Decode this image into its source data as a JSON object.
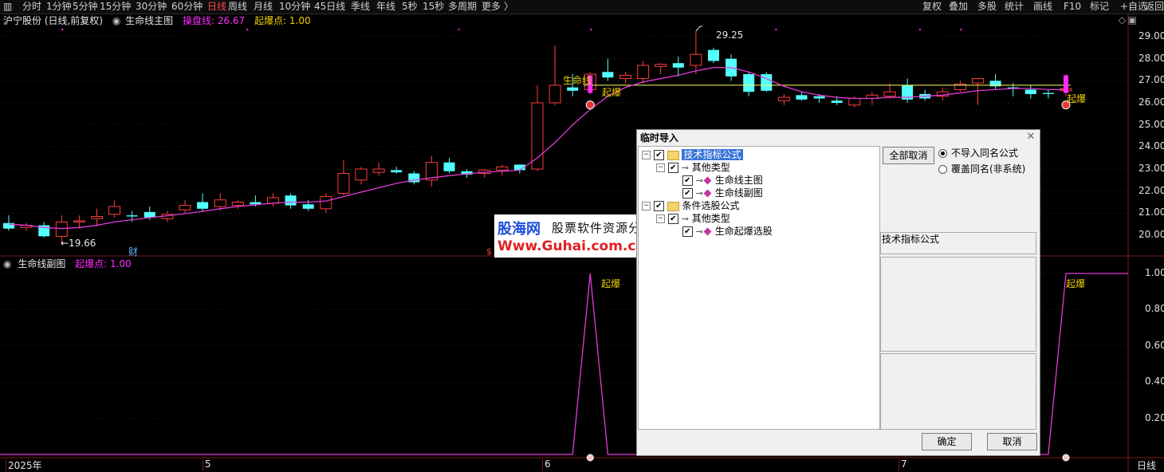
{
  "toolbar": {
    "menu_icon": "menu-icon",
    "periods": [
      {
        "label": "分时",
        "active": false
      },
      {
        "label": "1分钟",
        "active": false
      },
      {
        "label": "5分钟",
        "active": false
      },
      {
        "label": "15分钟",
        "active": false
      },
      {
        "label": "30分钟",
        "active": false
      },
      {
        "label": "60分钟",
        "active": false
      },
      {
        "label": "日线",
        "active": true
      },
      {
        "label": "周线",
        "active": false
      },
      {
        "label": "月线",
        "active": false
      },
      {
        "label": "10分钟",
        "active": false
      },
      {
        "label": "45日线",
        "active": false
      },
      {
        "label": "季线",
        "active": false
      },
      {
        "label": "年线",
        "active": false
      },
      {
        "label": "5秒",
        "active": false
      },
      {
        "label": "15秒",
        "active": false
      },
      {
        "label": "多周期",
        "active": false
      },
      {
        "label": "更多 〉",
        "active": false
      }
    ],
    "right_items": [
      "复权",
      "叠加",
      "多股",
      "统计",
      "画线",
      "F10",
      "标记",
      "+自选",
      "返回"
    ]
  },
  "main_chart": {
    "stock": "沪宁股份 (日线,前复权)",
    "indicator": "生命线主图",
    "line1_label": "操盘线: 26.67",
    "line2_label": "起爆点: 1.00",
    "price_ticks": [
      "29.00",
      "28.00",
      "27.00",
      "26.00",
      "25.00",
      "24.00",
      "23.00",
      "22.00",
      "21.00",
      "20.00"
    ],
    "high_label": "29.25",
    "low_label": "←19.66",
    "lifeline_text": "生命线",
    "burst_text": "起爆",
    "fin_marker": "财",
    "dollar_marker": "$"
  },
  "sub_chart": {
    "indicator": "生命线副图",
    "value_label": "起爆点: 1.00",
    "ticks": [
      "1.00",
      "0.80",
      "0.60",
      "0.40",
      "0.20"
    ],
    "burst_text": "起爆"
  },
  "date_axis": {
    "labels": [
      "2025年",
      "5",
      "6",
      "7"
    ],
    "period": "日线"
  },
  "colors": {
    "up": "#ff3d3d",
    "down": "#54ffff",
    "lifeline": "#e23bd8",
    "flat": "#ffff55",
    "accent": "#ff2bff",
    "yellow": "#f0d000"
  },
  "chart_data": {
    "type": "candlestick",
    "ylim": [
      19.5,
      29.5
    ],
    "candles": [
      {
        "o": 20.55,
        "h": 20.9,
        "l": 20.2,
        "c": 20.3
      },
      {
        "o": 20.35,
        "h": 20.55,
        "l": 20.2,
        "c": 20.45
      },
      {
        "o": 20.45,
        "h": 20.6,
        "l": 19.9,
        "c": 19.95
      },
      {
        "o": 19.95,
        "h": 20.9,
        "l": 19.66,
        "c": 20.6
      },
      {
        "o": 20.6,
        "h": 20.9,
        "l": 20.3,
        "c": 20.65
      },
      {
        "o": 20.75,
        "h": 21.2,
        "l": 20.4,
        "c": 20.85
      },
      {
        "o": 20.95,
        "h": 21.6,
        "l": 20.8,
        "c": 21.3
      },
      {
        "o": 20.9,
        "h": 21.1,
        "l": 20.6,
        "c": 20.85
      },
      {
        "o": 21.05,
        "h": 21.3,
        "l": 20.7,
        "c": 20.8
      },
      {
        "o": 20.75,
        "h": 21.1,
        "l": 20.6,
        "c": 20.95
      },
      {
        "o": 21.15,
        "h": 21.6,
        "l": 21.0,
        "c": 21.35
      },
      {
        "o": 21.5,
        "h": 21.9,
        "l": 21.1,
        "c": 21.2
      },
      {
        "o": 21.3,
        "h": 21.9,
        "l": 21.1,
        "c": 21.6
      },
      {
        "o": 21.35,
        "h": 21.6,
        "l": 21.2,
        "c": 21.5
      },
      {
        "o": 21.5,
        "h": 21.8,
        "l": 21.3,
        "c": 21.4
      },
      {
        "o": 21.45,
        "h": 21.9,
        "l": 21.3,
        "c": 21.7
      },
      {
        "o": 21.8,
        "h": 21.9,
        "l": 21.2,
        "c": 21.35
      },
      {
        "o": 21.4,
        "h": 21.6,
        "l": 21.1,
        "c": 21.2
      },
      {
        "o": 21.2,
        "h": 21.9,
        "l": 21.0,
        "c": 21.75
      },
      {
        "o": 21.9,
        "h": 23.4,
        "l": 21.8,
        "c": 22.8
      },
      {
        "o": 22.5,
        "h": 23.1,
        "l": 22.3,
        "c": 23.0
      },
      {
        "o": 22.85,
        "h": 23.3,
        "l": 22.7,
        "c": 23.0
      },
      {
        "o": 22.95,
        "h": 23.1,
        "l": 22.8,
        "c": 22.85
      },
      {
        "o": 22.8,
        "h": 22.9,
        "l": 22.3,
        "c": 22.4
      },
      {
        "o": 22.5,
        "h": 23.6,
        "l": 22.2,
        "c": 23.3
      },
      {
        "o": 23.3,
        "h": 23.5,
        "l": 22.8,
        "c": 22.9
      },
      {
        "o": 22.9,
        "h": 23.0,
        "l": 22.6,
        "c": 22.75
      },
      {
        "o": 22.8,
        "h": 23.0,
        "l": 22.6,
        "c": 22.95
      },
      {
        "o": 22.95,
        "h": 23.2,
        "l": 22.7,
        "c": 23.1
      },
      {
        "o": 23.2,
        "h": 23.2,
        "l": 22.8,
        "c": 22.95
      },
      {
        "o": 23.0,
        "h": 26.8,
        "l": 22.9,
        "c": 26.0
      },
      {
        "o": 26.0,
        "h": 28.6,
        "l": 25.9,
        "c": 26.8
      },
      {
        "o": 26.7,
        "h": 27.3,
        "l": 26.3,
        "c": 26.55
      },
      {
        "o": 26.6,
        "h": 27.4,
        "l": 26.4,
        "c": 27.3
      },
      {
        "o": 27.4,
        "h": 28.0,
        "l": 27.0,
        "c": 27.15
      },
      {
        "o": 27.1,
        "h": 27.4,
        "l": 26.9,
        "c": 27.25
      },
      {
        "o": 27.1,
        "h": 27.9,
        "l": 26.9,
        "c": 27.7
      },
      {
        "o": 27.65,
        "h": 27.8,
        "l": 27.3,
        "c": 27.75
      },
      {
        "o": 27.8,
        "h": 28.1,
        "l": 27.2,
        "c": 27.6
      },
      {
        "o": 27.7,
        "h": 29.25,
        "l": 27.3,
        "c": 28.2
      },
      {
        "o": 28.4,
        "h": 28.5,
        "l": 27.8,
        "c": 27.9
      },
      {
        "o": 28.0,
        "h": 28.2,
        "l": 27.0,
        "c": 27.2
      },
      {
        "o": 27.3,
        "h": 27.4,
        "l": 26.3,
        "c": 26.5
      },
      {
        "o": 27.3,
        "h": 27.4,
        "l": 26.5,
        "c": 26.55
      },
      {
        "o": 26.1,
        "h": 26.4,
        "l": 25.9,
        "c": 26.25
      },
      {
        "o": 26.35,
        "h": 26.5,
        "l": 26.1,
        "c": 26.15
      },
      {
        "o": 26.3,
        "h": 26.4,
        "l": 26.0,
        "c": 26.2
      },
      {
        "o": 26.1,
        "h": 26.3,
        "l": 25.9,
        "c": 26.0
      },
      {
        "o": 25.9,
        "h": 26.3,
        "l": 25.8,
        "c": 26.2
      },
      {
        "o": 26.2,
        "h": 26.5,
        "l": 25.9,
        "c": 26.35
      },
      {
        "o": 26.3,
        "h": 26.9,
        "l": 26.2,
        "c": 26.5
      },
      {
        "o": 26.8,
        "h": 27.1,
        "l": 26.0,
        "c": 26.15
      },
      {
        "o": 26.4,
        "h": 26.6,
        "l": 26.1,
        "c": 26.2
      },
      {
        "o": 26.3,
        "h": 26.7,
        "l": 26.1,
        "c": 26.5
      },
      {
        "o": 26.6,
        "h": 27.0,
        "l": 26.5,
        "c": 26.85
      },
      {
        "o": 26.9,
        "h": 27.1,
        "l": 25.9,
        "c": 27.1
      },
      {
        "o": 27.0,
        "h": 27.3,
        "l": 26.6,
        "c": 26.75
      },
      {
        "o": 26.7,
        "h": 26.9,
        "l": 26.3,
        "c": 26.65
      },
      {
        "o": 26.6,
        "h": 26.8,
        "l": 26.2,
        "c": 26.4
      },
      {
        "o": 26.45,
        "h": 26.6,
        "l": 26.2,
        "c": 26.4
      },
      {
        "o": 26.55,
        "h": 27.3,
        "l": 26.3,
        "c": 26.65
      }
    ],
    "lifeline": [
      20.5,
      20.45,
      20.35,
      20.3,
      20.35,
      20.45,
      20.6,
      20.7,
      20.8,
      20.88,
      20.98,
      21.08,
      21.2,
      21.3,
      21.38,
      21.45,
      21.5,
      21.5,
      21.55,
      21.75,
      21.95,
      22.15,
      22.35,
      22.5,
      22.6,
      22.7,
      22.78,
      22.85,
      22.9,
      22.95,
      23.5,
      24.2,
      25.0,
      25.7,
      26.3,
      26.7,
      26.95,
      27.1,
      27.25,
      27.45,
      27.6,
      27.6,
      27.4,
      27.1,
      26.75,
      26.5,
      26.35,
      26.25,
      26.2,
      26.2,
      26.25,
      26.25,
      26.3,
      26.35,
      26.45,
      26.55,
      26.6,
      26.65,
      26.65,
      26.6,
      26.6
    ],
    "flat_line": {
      "value": 26.8,
      "from_index": 33,
      "to_index": 60
    },
    "burst_points": [
      33,
      60
    ],
    "sub_values_nonzero": [
      33,
      60
    ]
  },
  "dialog": {
    "title": "临时导入",
    "tree": [
      {
        "label": "技术指标公式",
        "level": 0,
        "kind": "folder",
        "selected": true,
        "checked": true
      },
      {
        "label": "其他类型",
        "level": 1,
        "kind": "key",
        "checked": true
      },
      {
        "label": "生命线主图",
        "level": 2,
        "kind": "gem",
        "checked": true
      },
      {
        "label": "生命线副图",
        "level": 2,
        "kind": "gem",
        "checked": true
      },
      {
        "label": "条件选股公式",
        "level": 0,
        "kind": "folder",
        "checked": true
      },
      {
        "label": "其他类型",
        "level": 1,
        "kind": "key",
        "checked": true
      },
      {
        "label": "生命起爆选股",
        "level": 2,
        "kind": "gem",
        "checked": true
      }
    ],
    "cancel_all_label": "全部取消",
    "radio_options": [
      {
        "label": "不导入同名公式",
        "checked": true
      },
      {
        "label": "覆盖同名(非系统)",
        "checked": false
      }
    ],
    "info_label": "技术指标公式",
    "ok_label": "确定",
    "cancel_label": "取消"
  },
  "watermark": {
    "brand": "股海网",
    "slogan": "股票软件资源分享",
    "url": "Www.Guhai.com.cn"
  }
}
